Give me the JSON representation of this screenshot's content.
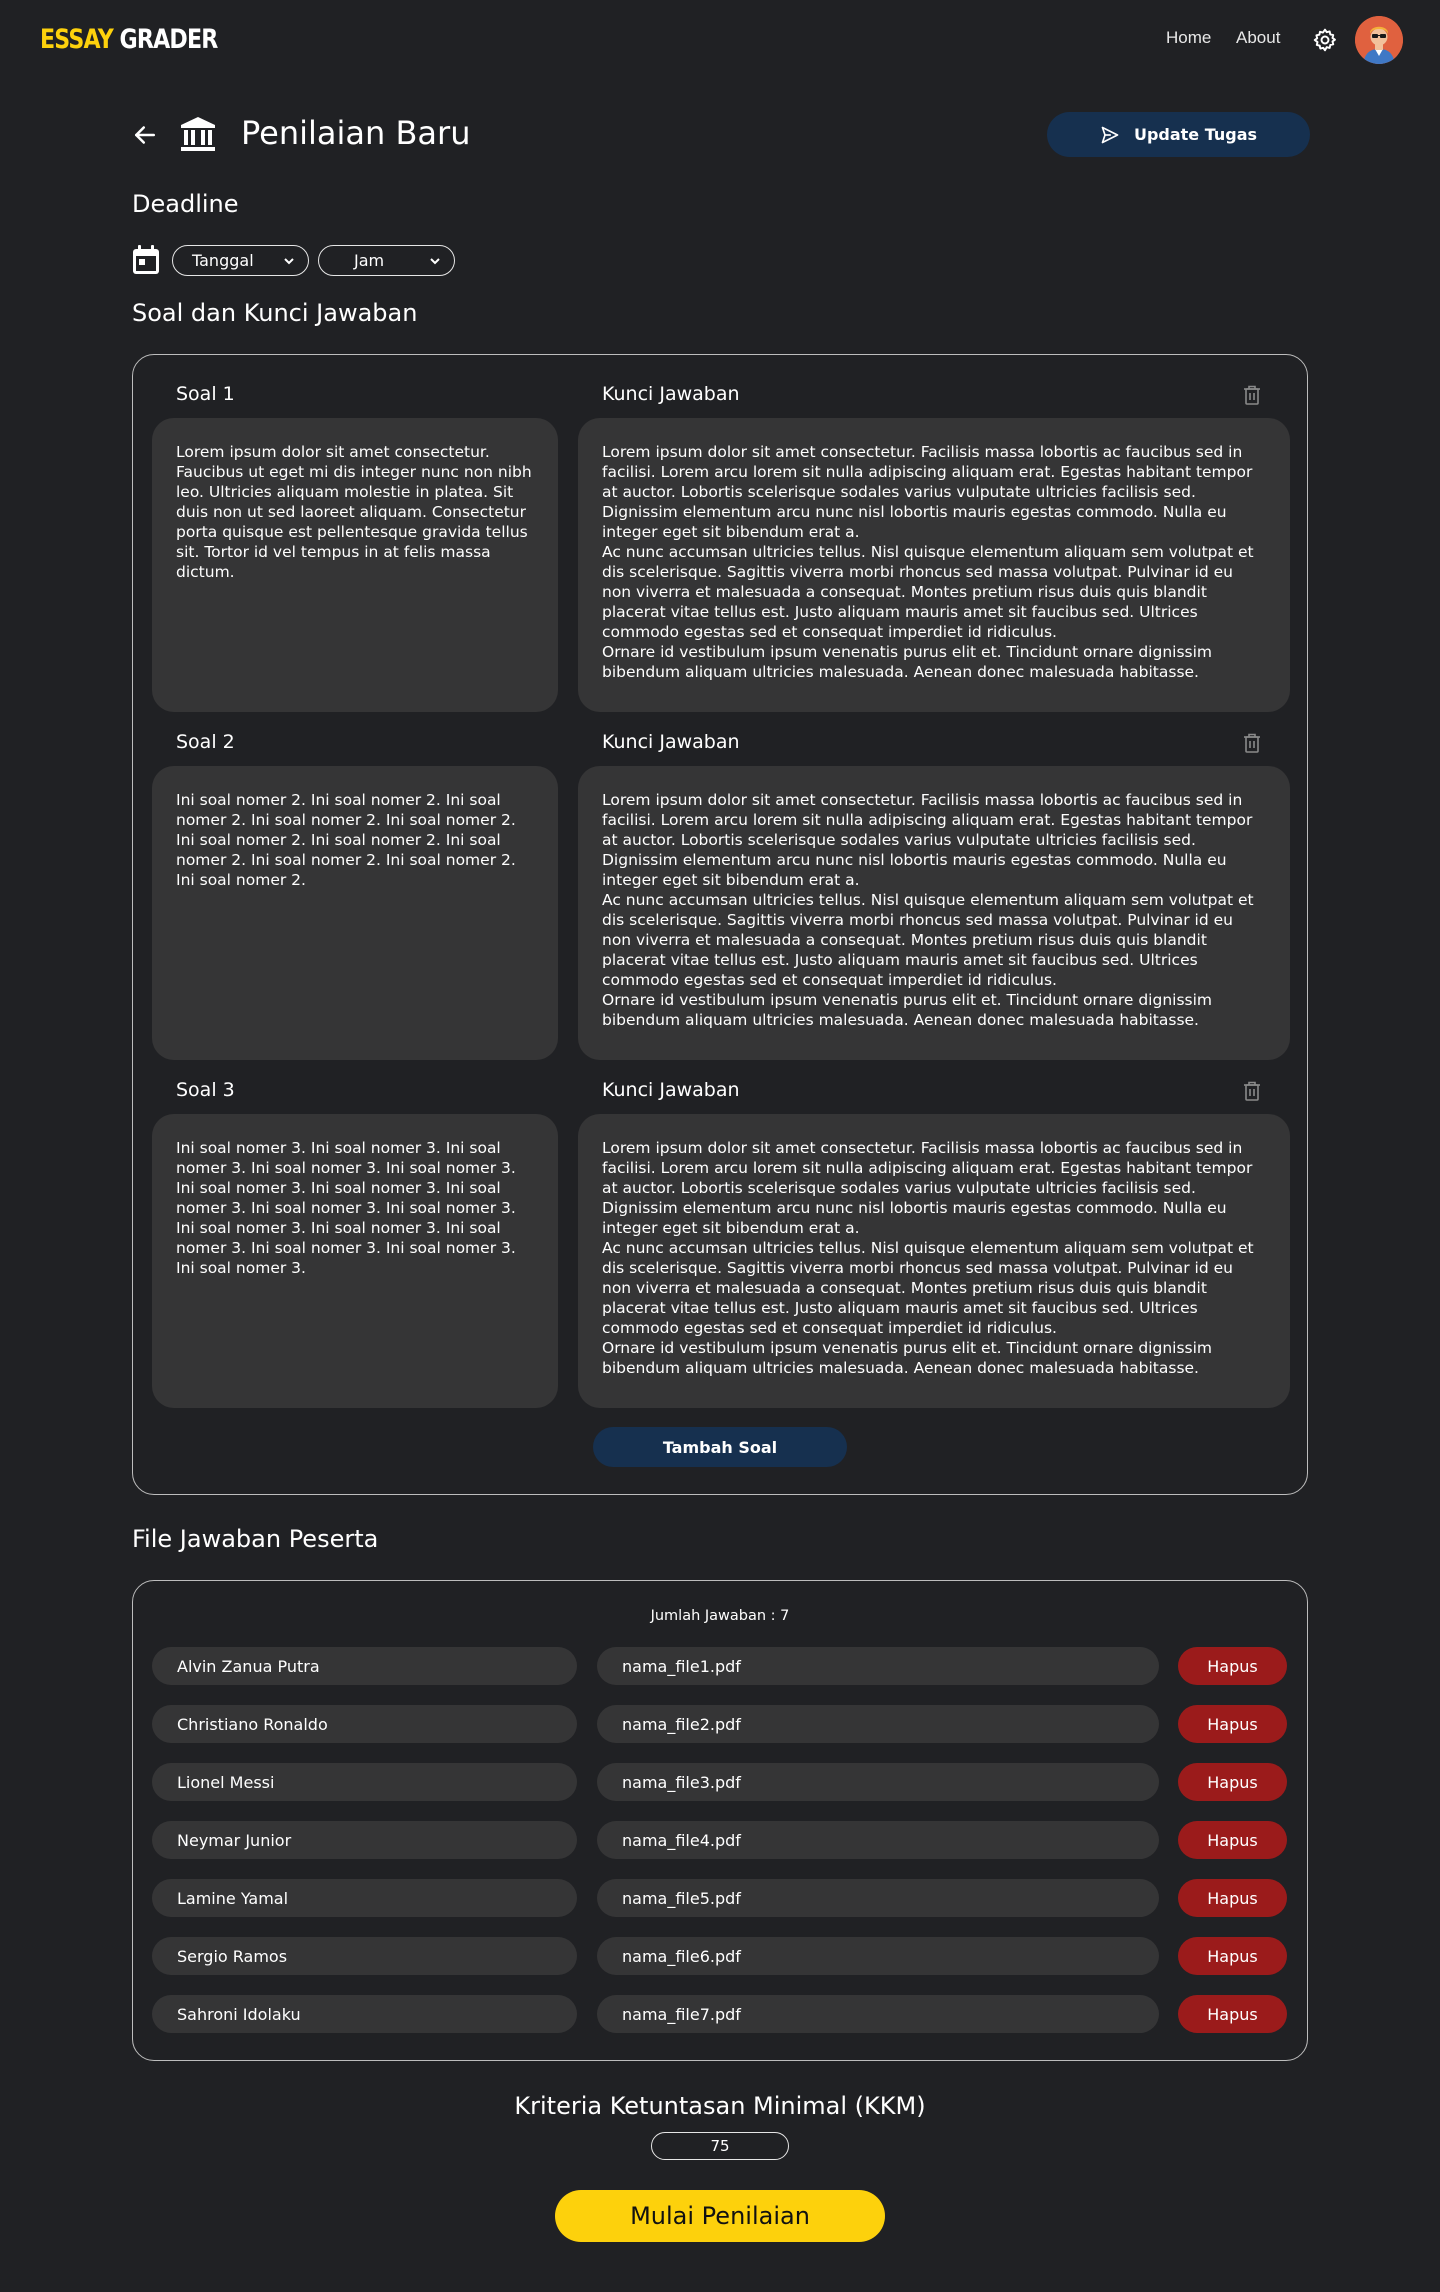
{
  "nav": {
    "logo_part1": "ESSAY",
    "logo_part2": "GRADER",
    "home": "Home",
    "about": "About",
    "settings_icon": "gear-icon",
    "avatar_icon": "user-avatar"
  },
  "header": {
    "title": "Penilaian Baru",
    "back_icon": "arrow-left-icon",
    "title_icon": "bank-icon",
    "update_button": "Update Tugas",
    "update_icon": "send-icon"
  },
  "deadline": {
    "title": "Deadline",
    "calendar_icon": "calendar-icon",
    "date_placeholder": "Tanggal",
    "time_placeholder": "Jam"
  },
  "soal_section": {
    "title": "Soal dan Kunci Jawaban",
    "items": [
      {
        "label": "Soal 1",
        "key_label": "Kunci Jawaban",
        "question": "Lorem ipsum dolor sit amet consectetur. Faucibus ut eget mi dis integer nunc non nibh leo. Ultricies aliquam molestie in platea. Sit duis non ut sed laoreet aliquam. Consectetur porta quisque est pellentesque gravida tellus sit. Tortor id vel tempus in at felis massa dictum.",
        "answer": "Lorem ipsum dolor sit amet consectetur. Facilisis massa lobortis ac faucibus sed in facilisi. Lorem arcu lorem sit nulla adipiscing aliquam erat. Egestas habitant tempor at auctor. Lobortis scelerisque sodales varius vulputate ultricies facilisis sed. Dignissim elementum arcu nunc nisl lobortis mauris egestas commodo. Nulla eu integer eget sit bibendum erat a.\nAc nunc accumsan ultricies tellus. Nisl quisque elementum aliquam sem volutpat et dis scelerisque. Sagittis viverra morbi rhoncus sed massa volutpat. Pulvinar id eu non viverra et malesuada a consequat. Montes pretium risus duis quis blandit placerat vitae tellus est. Justo aliquam mauris amet sit faucibus sed. Ultrices commodo egestas sed et consequat imperdiet id ridiculus.\nOrnare id vestibulum ipsum venenatis purus elit et. Tincidunt ornare dignissim bibendum aliquam ultricies malesuada. Aenean donec malesuada habitasse."
      },
      {
        "label": "Soal 2",
        "key_label": "Kunci Jawaban",
        "question": "Ini soal nomer 2. Ini soal nomer 2. Ini soal nomer 2. Ini soal nomer 2. Ini soal nomer 2. Ini soal nomer 2. Ini soal nomer 2. Ini soal nomer 2. Ini soal nomer 2. Ini soal nomer 2. Ini soal nomer 2.",
        "answer": "Lorem ipsum dolor sit amet consectetur. Facilisis massa lobortis ac faucibus sed in facilisi. Lorem arcu lorem sit nulla adipiscing aliquam erat. Egestas habitant tempor at auctor. Lobortis scelerisque sodales varius vulputate ultricies facilisis sed. Dignissim elementum arcu nunc nisl lobortis mauris egestas commodo. Nulla eu integer eget sit bibendum erat a.\nAc nunc accumsan ultricies tellus. Nisl quisque elementum aliquam sem volutpat et dis scelerisque. Sagittis viverra morbi rhoncus sed massa volutpat. Pulvinar id eu non viverra et malesuada a consequat. Montes pretium risus duis quis blandit placerat vitae tellus est. Justo aliquam mauris amet sit faucibus sed. Ultrices commodo egestas sed et consequat imperdiet id ridiculus.\nOrnare id vestibulum ipsum venenatis purus elit et. Tincidunt ornare dignissim bibendum aliquam ultricies malesuada. Aenean donec malesuada habitasse."
      },
      {
        "label": "Soal 3",
        "key_label": "Kunci Jawaban",
        "question": "Ini soal nomer 3. Ini soal nomer 3. Ini soal nomer 3. Ini soal nomer 3. Ini soal nomer 3. Ini soal nomer 3. Ini soal nomer 3. Ini soal nomer 3. Ini soal nomer 3. Ini soal nomer 3. Ini soal nomer 3. Ini soal nomer 3. Ini soal nomer 3. Ini soal nomer 3. Ini soal nomer 3. Ini soal nomer 3.",
        "answer": "Lorem ipsum dolor sit amet consectetur. Facilisis massa lobortis ac faucibus sed in facilisi. Lorem arcu lorem sit nulla adipiscing aliquam erat. Egestas habitant tempor at auctor. Lobortis scelerisque sodales varius vulputate ultricies facilisis sed. Dignissim elementum arcu nunc nisl lobortis mauris egestas commodo. Nulla eu integer eget sit bibendum erat a.\nAc nunc accumsan ultricies tellus. Nisl quisque elementum aliquam sem volutpat et dis scelerisque. Sagittis viverra morbi rhoncus sed massa volutpat. Pulvinar id eu non viverra et malesuada a consequat. Montes pretium risus duis quis blandit placerat vitae tellus est. Justo aliquam mauris amet sit faucibus sed. Ultrices commodo egestas sed et consequat imperdiet id ridiculus.\nOrnare id vestibulum ipsum venenatis purus elit et. Tincidunt ornare dignissim bibendum aliquam ultricies malesuada. Aenean donec malesuada habitasse."
      }
    ],
    "delete_icon": "trash-icon",
    "add_button": "Tambah Soal"
  },
  "files_section": {
    "title": "File Jawaban Peserta",
    "count_label": "Jumlah Jawaban : 7",
    "delete_label": "Hapus",
    "rows": [
      {
        "name": "Alvin Zanua Putra",
        "file": "nama_file1.pdf"
      },
      {
        "name": "Christiano Ronaldo",
        "file": "nama_file2.pdf"
      },
      {
        "name": "Lionel Messi",
        "file": "nama_file3.pdf"
      },
      {
        "name": "Neymar Junior",
        "file": "nama_file4.pdf"
      },
      {
        "name": "Lamine Yamal",
        "file": "nama_file5.pdf"
      },
      {
        "name": "Sergio Ramos",
        "file": "nama_file6.pdf"
      },
      {
        "name": "Sahroni Idolaku",
        "file": "nama_file7.pdf"
      }
    ]
  },
  "kkm": {
    "title": "Kriteria Ketuntasan Minimal (KKM)",
    "value": "75"
  },
  "start_button": "Mulai Penilaian",
  "colors": {
    "background": "#202124",
    "card": "#353536",
    "accent_yellow": "#fdd10c",
    "navy_button": "#16304f",
    "danger": "#9b1b1b"
  }
}
